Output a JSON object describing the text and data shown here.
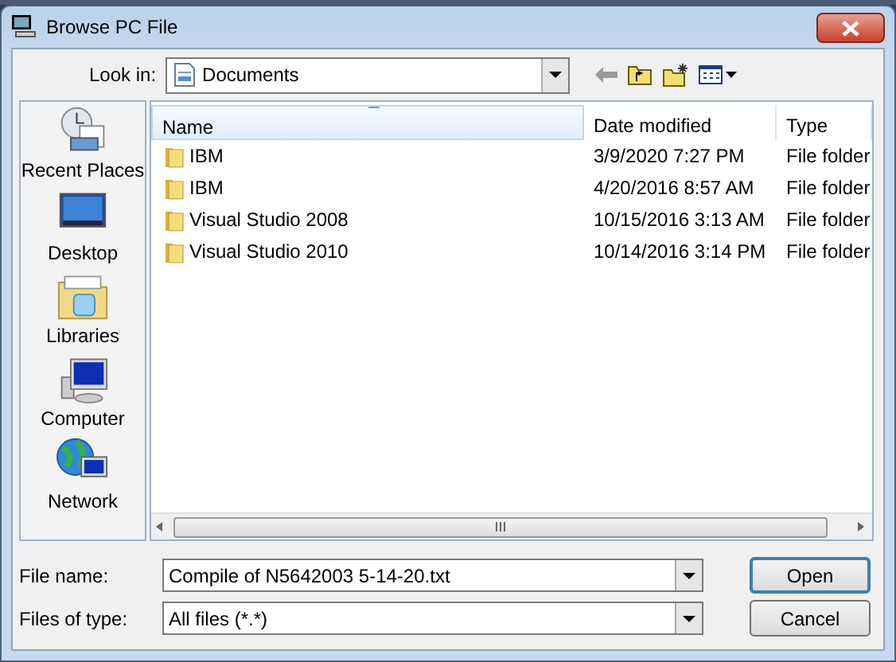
{
  "window": {
    "title": "Browse PC File"
  },
  "look_in": {
    "label": "Look in:",
    "value": "Documents"
  },
  "places": [
    {
      "kind": "recent",
      "label": "Recent Places"
    },
    {
      "kind": "desktop",
      "label": "Desktop"
    },
    {
      "kind": "libraries",
      "label": "Libraries"
    },
    {
      "kind": "computer",
      "label": "Computer"
    },
    {
      "kind": "network",
      "label": "Network"
    }
  ],
  "table": {
    "columns": [
      {
        "label": "Name",
        "sorted": true
      },
      {
        "label": "Date modified",
        "sorted": false
      },
      {
        "label": "Type",
        "sorted": false
      }
    ],
    "rows": [
      {
        "name": "IBM",
        "date": "3/9/2020 7:27 PM",
        "type": "File folder"
      },
      {
        "name": "IBM",
        "date": "4/20/2016 8:57 AM",
        "type": "File folder"
      },
      {
        "name": "Visual Studio 2008",
        "date": "10/15/2016 3:13 AM",
        "type": "File folder"
      },
      {
        "name": "Visual Studio 2010",
        "date": "10/14/2016 3:14 PM",
        "type": "File folder"
      }
    ]
  },
  "file_name": {
    "label": "File name:",
    "value": "Compile of N5642003 5-14-20.txt"
  },
  "file_type": {
    "label": "Files of type:",
    "value": "All files (*.*)"
  },
  "buttons": [
    "Open",
    "Cancel"
  ]
}
